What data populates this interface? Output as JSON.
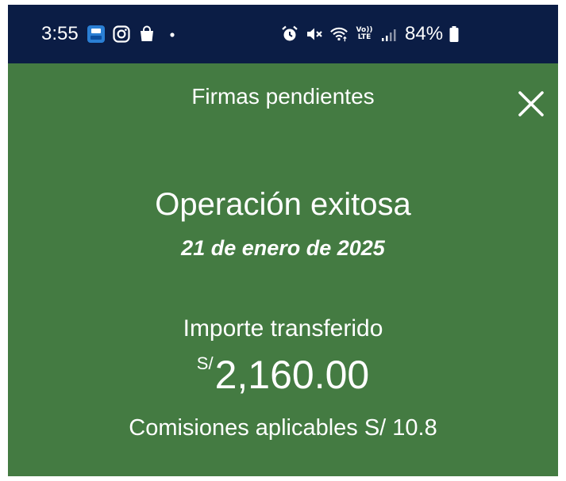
{
  "status_bar": {
    "time": "3:55",
    "battery": "84%",
    "network": "LTE",
    "volte": "Vo))",
    "icons_left": [
      "bbva-app-icon",
      "instagram-icon",
      "shopping-bag-icon",
      "dot-icon"
    ],
    "icons_right": [
      "alarm-icon",
      "mute-icon",
      "wifi-icon",
      "volte-lte-icon",
      "signal-icon",
      "battery-icon"
    ]
  },
  "header": {
    "title": "Firmas pendientes",
    "close_icon": "close-icon"
  },
  "result": {
    "headline": "Operación exitosa",
    "date": "21 de enero de 2025",
    "amount_label": "Importe transferido",
    "currency": "S/",
    "amount": "2,160.00",
    "fees": "Comisiones aplicables S/ 10.8"
  },
  "colors": {
    "status_bar_bg": "#0b1d45",
    "panel_bg": "#447b42",
    "text": "#ffffff"
  }
}
